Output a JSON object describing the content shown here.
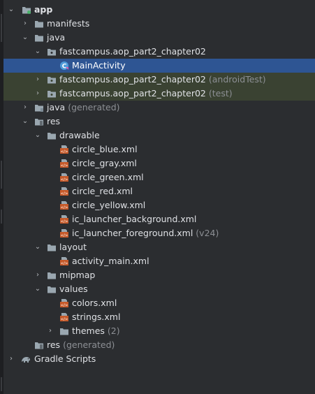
{
  "tree": {
    "app": "app",
    "manifests": "manifests",
    "java": "java",
    "pkg_main": "fastcampus.aop_part2_chapter02",
    "main_activity": "MainActivity",
    "pkg_android_test": "fastcampus.aop_part2_chapter02",
    "pkg_android_test_hint": "(androidTest)",
    "pkg_test": "fastcampus.aop_part2_chapter02",
    "pkg_test_hint": "(test)",
    "java_generated": "java",
    "java_generated_hint": "(generated)",
    "res": "res",
    "drawable": "drawable",
    "circle_blue": "circle_blue.xml",
    "circle_gray": "circle_gray.xml",
    "circle_green": "circle_green.xml",
    "circle_red": "circle_red.xml",
    "circle_yellow": "circle_yellow.xml",
    "ic_launcher_background": "ic_launcher_background.xml",
    "ic_launcher_foreground": "ic_launcher_foreground.xml",
    "ic_launcher_foreground_hint": "(v24)",
    "layout": "layout",
    "activity_main": "activity_main.xml",
    "mipmap": "mipmap",
    "values": "values",
    "colors": "colors.xml",
    "strings": "strings.xml",
    "themes": "themes",
    "themes_hint": "(2)",
    "res_generated": "res",
    "res_generated_hint": "(generated)",
    "gradle_scripts": "Gradle Scripts"
  },
  "colors": {
    "background": "#2b2d30",
    "selection": "#2e5593",
    "test_highlight": "#3a4232",
    "folder": "#9aa7b0",
    "xml_icon": "#c75a2a",
    "class_icon": "#4f9bd9"
  },
  "icons": {
    "module": "module-folder-icon",
    "folder": "folder-icon",
    "package": "package-icon",
    "class": "class-icon",
    "xml": "xml-resource-icon",
    "gradle": "gradle-elephant-icon"
  }
}
